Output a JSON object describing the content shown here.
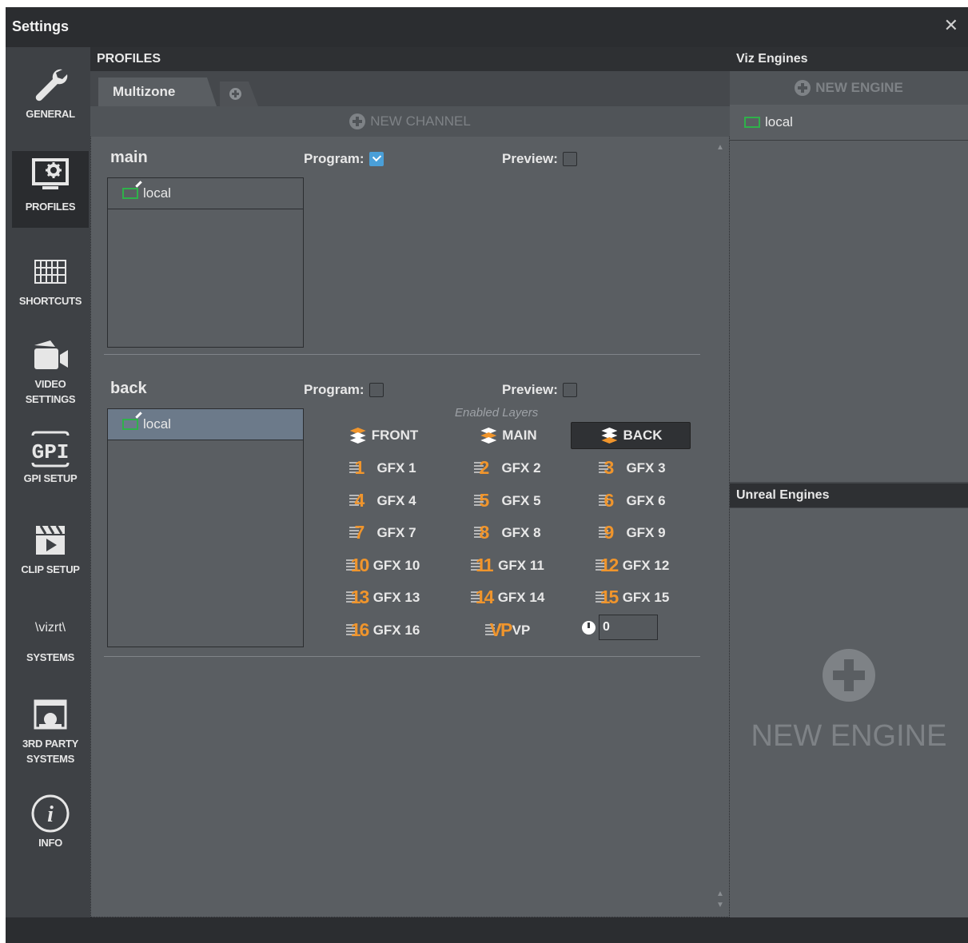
{
  "window": {
    "title": "Settings",
    "close_glyph": "✕"
  },
  "sidebar": {
    "items": [
      {
        "label": "GENERAL",
        "icon": "wrench-icon",
        "active": false
      },
      {
        "label": "PROFILES",
        "icon": "monitor-gear-icon",
        "active": true
      },
      {
        "label": "SHORTCUTS",
        "icon": "keyboard-icon",
        "active": false
      },
      {
        "label": "VIDEO\nSETTINGS",
        "icon": "video-camera-icon",
        "active": false
      },
      {
        "label": "GPI SETUP",
        "icon": "gpi-icon",
        "active": false
      },
      {
        "label": "CLIP SETUP",
        "icon": "clapperboard-icon",
        "active": false
      },
      {
        "label": "SYSTEMS",
        "icon": "vizrt-logo-icon",
        "logo_text": "\\vizrt\\",
        "active": false
      },
      {
        "label": "3RD PARTY\nSYSTEMS",
        "icon": "third-party-icon",
        "active": false
      },
      {
        "label": "INFO",
        "icon": "info-icon",
        "active": false
      }
    ]
  },
  "profiles": {
    "header": "PROFILES",
    "tabs": [
      {
        "label": "Multizone",
        "active": true
      }
    ],
    "new_channel_label": "NEW CHANNEL",
    "channels": [
      {
        "name": "main",
        "program_label": "Program:",
        "program_checked": true,
        "preview_label": "Preview:",
        "preview_checked": false,
        "engines": [
          {
            "name": "local",
            "selected": false
          }
        ]
      },
      {
        "name": "back",
        "program_label": "Program:",
        "program_checked": false,
        "preview_label": "Preview:",
        "preview_checked": false,
        "engines": [
          {
            "name": "local",
            "selected": true
          }
        ],
        "layers_caption": "Enabled Layers",
        "layers": [
          {
            "label": "FRONT",
            "active": false
          },
          {
            "label": "MAIN",
            "active": false
          },
          {
            "label": "BACK",
            "active": true
          }
        ],
        "gfx": [
          {
            "num": "1",
            "label": "GFX 1"
          },
          {
            "num": "2",
            "label": "GFX 2"
          },
          {
            "num": "3",
            "label": "GFX 3"
          },
          {
            "num": "4",
            "label": "GFX 4"
          },
          {
            "num": "5",
            "label": "GFX 5"
          },
          {
            "num": "6",
            "label": "GFX 6"
          },
          {
            "num": "7",
            "label": "GFX 7"
          },
          {
            "num": "8",
            "label": "GFX 8"
          },
          {
            "num": "9",
            "label": "GFX 9"
          },
          {
            "num": "10",
            "label": "GFX 10"
          },
          {
            "num": "11",
            "label": "GFX 11"
          },
          {
            "num": "12",
            "label": "GFX 12"
          },
          {
            "num": "13",
            "label": "GFX 13"
          },
          {
            "num": "14",
            "label": "GFX 14"
          },
          {
            "num": "15",
            "label": "GFX 15"
          },
          {
            "num": "16",
            "label": "GFX 16"
          },
          {
            "num": "VP",
            "label": "VP"
          }
        ],
        "timer_value": "0"
      }
    ]
  },
  "viz_engines": {
    "header": "Viz Engines",
    "new_label": "NEW ENGINE",
    "items": [
      {
        "name": "local"
      }
    ]
  },
  "unreal_engines": {
    "header": "Unreal Engines",
    "new_label": "NEW ENGINE"
  },
  "colors": {
    "accent_orange": "#f0952c",
    "engine_green": "#2fb14a",
    "checkbox_blue": "#4a9fd8",
    "selected_row": "#6c7a8a"
  }
}
